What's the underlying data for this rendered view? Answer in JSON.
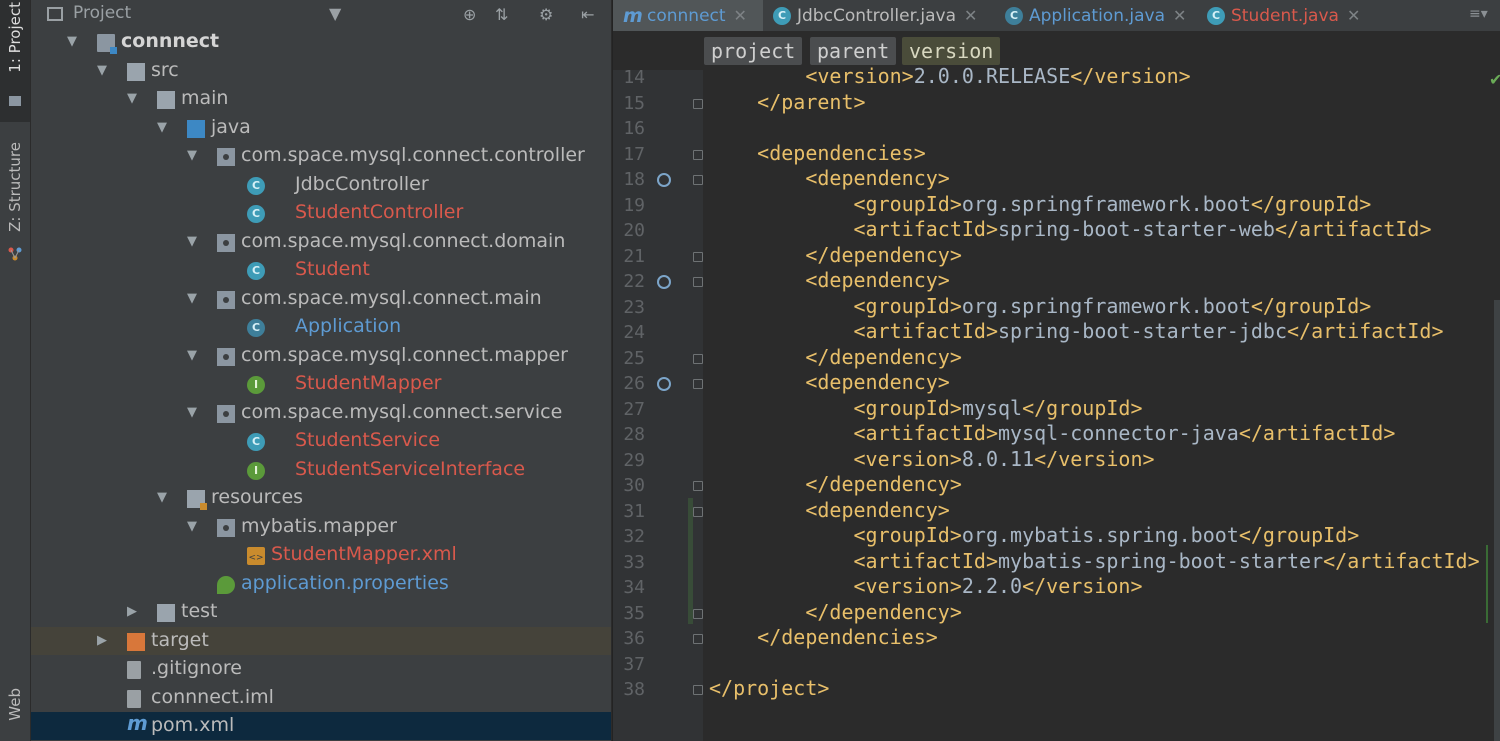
{
  "sidebar_tabs": [
    {
      "label": "1: Project",
      "icon": "folder-icon"
    },
    {
      "label": "Z: Structure",
      "icon": "structure-icon"
    },
    {
      "label": "Web",
      "icon": "web-icon"
    }
  ],
  "project_panel": {
    "title": "Project",
    "tree": [
      {
        "label": "connnect",
        "icon": "module-folder-icon",
        "expanded": true
      },
      {
        "label": "src",
        "icon": "folder-icon",
        "expanded": true
      },
      {
        "label": "main",
        "icon": "folder-icon",
        "expanded": true
      },
      {
        "label": "java",
        "icon": "source-folder-icon",
        "expanded": true
      },
      {
        "label": "com.space.mysql.connect.controller",
        "icon": "package-icon",
        "expanded": true
      },
      {
        "label": "JdbcController",
        "icon": "class-icon"
      },
      {
        "label": "StudentController",
        "icon": "class-icon"
      },
      {
        "label": "com.space.mysql.connect.domain",
        "icon": "package-icon",
        "expanded": true
      },
      {
        "label": "Student",
        "icon": "class-icon"
      },
      {
        "label": "com.space.mysql.connect.main",
        "icon": "package-icon",
        "expanded": true
      },
      {
        "label": "Application",
        "icon": "spring-boot-class-icon"
      },
      {
        "label": "com.space.mysql.connect.mapper",
        "icon": "package-icon",
        "expanded": true
      },
      {
        "label": "StudentMapper",
        "icon": "interface-icon"
      },
      {
        "label": "com.space.mysql.connect.service",
        "icon": "package-icon",
        "expanded": true
      },
      {
        "label": "StudentService",
        "icon": "class-icon"
      },
      {
        "label": "StudentServiceInterface",
        "icon": "interface-icon"
      },
      {
        "label": "resources",
        "icon": "resources-folder-icon",
        "expanded": true
      },
      {
        "label": "mybatis.mapper",
        "icon": "package-icon",
        "expanded": true
      },
      {
        "label": "StudentMapper.xml",
        "icon": "xml-file-icon"
      },
      {
        "label": "application.properties",
        "icon": "properties-file-icon"
      },
      {
        "label": "test",
        "icon": "folder-icon",
        "expanded": false
      },
      {
        "label": "target",
        "icon": "excluded-folder-icon",
        "expanded": false
      },
      {
        "label": ".gitignore",
        "icon": "file-icon"
      },
      {
        "label": "connnect.iml",
        "icon": "iml-file-icon"
      },
      {
        "label": "pom.xml",
        "icon": "maven-icon"
      }
    ]
  },
  "editor": {
    "tabs": [
      {
        "label": "connnect",
        "icon": "maven-icon",
        "active": true
      },
      {
        "label": "JdbcController.java",
        "icon": "class-icon"
      },
      {
        "label": "Application.java",
        "icon": "spring-boot-class-icon"
      },
      {
        "label": "Student.java",
        "icon": "class-icon"
      }
    ],
    "breadcrumbs": [
      "project",
      "parent",
      "version"
    ],
    "lines": [
      {
        "num": "14",
        "text": "        <version>2.0.0.RELEASE</version>"
      },
      {
        "num": "15",
        "text": "    </parent>"
      },
      {
        "num": "16",
        "text": ""
      },
      {
        "num": "17",
        "text": "    <dependencies>"
      },
      {
        "num": "18",
        "text": "        <dependency>"
      },
      {
        "num": "19",
        "text": "            <groupId>org.springframework.boot</groupId>"
      },
      {
        "num": "20",
        "text": "            <artifactId>spring-boot-starter-web</artifactId>"
      },
      {
        "num": "21",
        "text": "        </dependency>"
      },
      {
        "num": "22",
        "text": "        <dependency>"
      },
      {
        "num": "23",
        "text": "            <groupId>org.springframework.boot</groupId>"
      },
      {
        "num": "24",
        "text": "            <artifactId>spring-boot-starter-jdbc</artifactId>"
      },
      {
        "num": "25",
        "text": "        </dependency>"
      },
      {
        "num": "26",
        "text": "        <dependency>"
      },
      {
        "num": "27",
        "text": "            <groupId>mysql</groupId>"
      },
      {
        "num": "28",
        "text": "            <artifactId>mysql-connector-java</artifactId>"
      },
      {
        "num": "29",
        "text": "            <version>8.0.11</version>"
      },
      {
        "num": "30",
        "text": "        </dependency>"
      },
      {
        "num": "31",
        "text": "        <dependency>"
      },
      {
        "num": "32",
        "text": "            <groupId>org.mybatis.spring.boot</groupId>"
      },
      {
        "num": "33",
        "text": "            <artifactId>mybatis-spring-boot-starter</artifactId>"
      },
      {
        "num": "34",
        "text": "            <version>2.2.0</version>"
      },
      {
        "num": "35",
        "text": "        </dependency>"
      },
      {
        "num": "36",
        "text": "    </dependencies>"
      },
      {
        "num": "37",
        "text": ""
      },
      {
        "num": "38",
        "text": "</project>"
      }
    ]
  },
  "colors": {
    "tag": "#e8bf6a",
    "text": "#a9b7c6",
    "modified": "#d9594c",
    "vcs_new": "#5e9bd3"
  }
}
